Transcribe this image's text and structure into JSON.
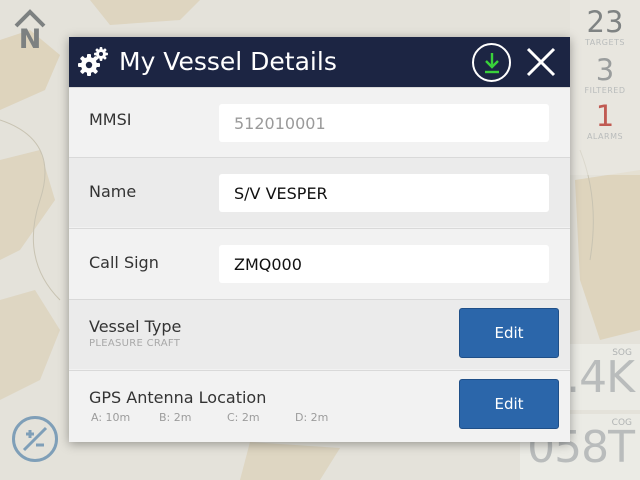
{
  "chart": {
    "background_color": "#e4e2da",
    "land_color": "#d9c9a6",
    "targets": {
      "count": "23",
      "label": "TARGETS"
    },
    "filtered": {
      "count": "3",
      "label": "FILTERED"
    },
    "alarms": {
      "count": "1",
      "label": "ALARMS"
    },
    "sog": {
      "label": "SOG",
      "value": ".4K"
    },
    "cog": {
      "label": "COG",
      "value": "058T"
    },
    "north_icon": "north-up-icon",
    "orientation_icon": "orientation-toggle-icon"
  },
  "dialog": {
    "title": "My Vessel Details",
    "header_color": "#1c2543",
    "icons": {
      "title": "gears-icon",
      "download": "download-icon",
      "close": "close-icon"
    },
    "mmsi": {
      "label": "MMSI",
      "value": "512010001"
    },
    "name": {
      "label": "Name",
      "value": "S/V VESPER"
    },
    "call_sign": {
      "label": "Call Sign",
      "value": "ZMQ000"
    },
    "vessel_type": {
      "label": "Vessel Type",
      "value": "PLEASURE CRAFT",
      "button_label": "Edit"
    },
    "gps_antenna": {
      "label": "GPS Antenna Location",
      "button_label": "Edit",
      "a": "A:  10m",
      "b": "B:  2m",
      "c": "C:  2m",
      "d": "D:  2m"
    },
    "accent_color": "#2b66aa",
    "download_color": "#39d13a"
  }
}
